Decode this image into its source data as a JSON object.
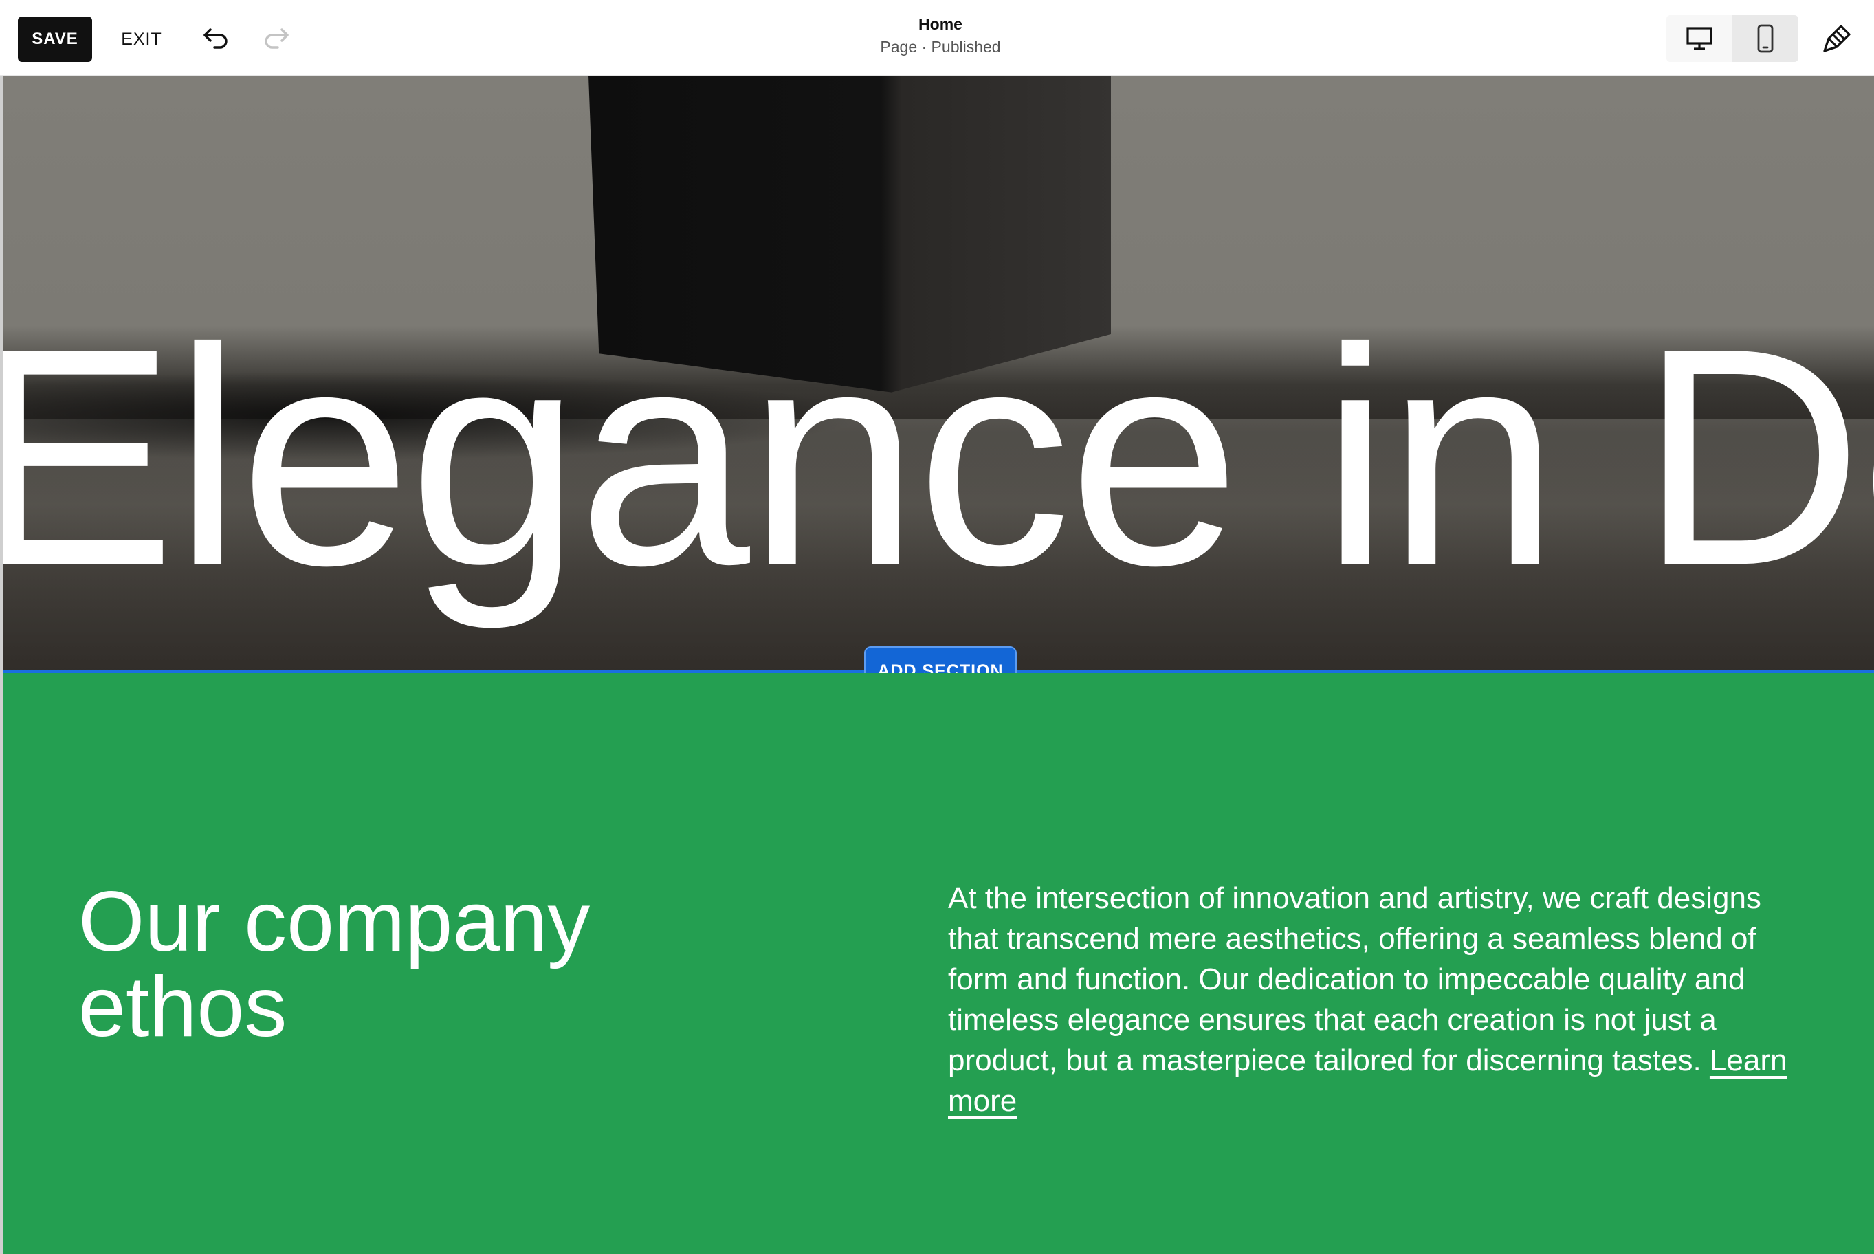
{
  "toolbar": {
    "save_label": "SAVE",
    "exit_label": "EXIT",
    "undo_icon": "undo-icon",
    "redo_icon": "redo-icon",
    "page_title": "Home",
    "page_status": "Page · Published",
    "device_options": [
      "desktop",
      "mobile"
    ],
    "selected_device": "desktop",
    "design_icon": "paintbrush-icon"
  },
  "hero": {
    "headline": "Elegance in Design"
  },
  "add_section": {
    "label": "ADD SECTION"
  },
  "content_section": {
    "heading": "Our company ethos",
    "body": "At the intersection of innovation and artistry, we craft designs that transcend mere aesthetics, offering a seamless blend of form and function. Our dedication to impeccable quality and timeless elegance ensures that each creation is not just a product, but a masterpiece tailored for discerning tastes.",
    "link_label": "Learn more",
    "background_color": "#249f51"
  },
  "colors": {
    "accent": "#1366d6",
    "save_button": "#111111"
  }
}
